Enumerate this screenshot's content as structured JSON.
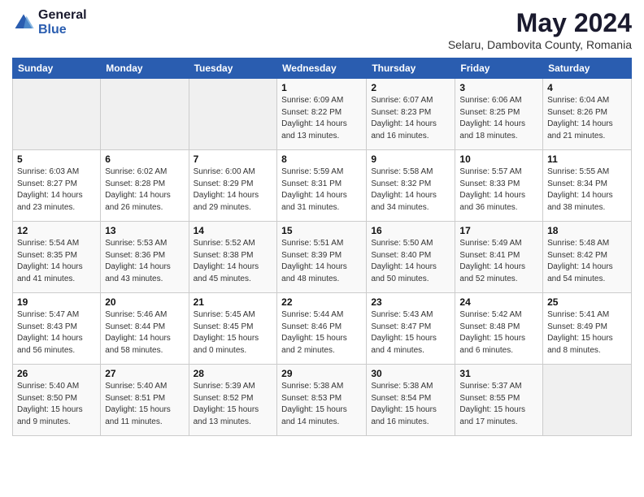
{
  "header": {
    "logo_general": "General",
    "logo_blue": "Blue",
    "title": "May 2024",
    "subtitle": "Selaru, Dambovita County, Romania"
  },
  "columns": [
    "Sunday",
    "Monday",
    "Tuesday",
    "Wednesday",
    "Thursday",
    "Friday",
    "Saturday"
  ],
  "weeks": [
    [
      {
        "day": "",
        "info": ""
      },
      {
        "day": "",
        "info": ""
      },
      {
        "day": "",
        "info": ""
      },
      {
        "day": "1",
        "info": "Sunrise: 6:09 AM\nSunset: 8:22 PM\nDaylight: 14 hours\nand 13 minutes."
      },
      {
        "day": "2",
        "info": "Sunrise: 6:07 AM\nSunset: 8:23 PM\nDaylight: 14 hours\nand 16 minutes."
      },
      {
        "day": "3",
        "info": "Sunrise: 6:06 AM\nSunset: 8:25 PM\nDaylight: 14 hours\nand 18 minutes."
      },
      {
        "day": "4",
        "info": "Sunrise: 6:04 AM\nSunset: 8:26 PM\nDaylight: 14 hours\nand 21 minutes."
      }
    ],
    [
      {
        "day": "5",
        "info": "Sunrise: 6:03 AM\nSunset: 8:27 PM\nDaylight: 14 hours\nand 23 minutes."
      },
      {
        "day": "6",
        "info": "Sunrise: 6:02 AM\nSunset: 8:28 PM\nDaylight: 14 hours\nand 26 minutes."
      },
      {
        "day": "7",
        "info": "Sunrise: 6:00 AM\nSunset: 8:29 PM\nDaylight: 14 hours\nand 29 minutes."
      },
      {
        "day": "8",
        "info": "Sunrise: 5:59 AM\nSunset: 8:31 PM\nDaylight: 14 hours\nand 31 minutes."
      },
      {
        "day": "9",
        "info": "Sunrise: 5:58 AM\nSunset: 8:32 PM\nDaylight: 14 hours\nand 34 minutes."
      },
      {
        "day": "10",
        "info": "Sunrise: 5:57 AM\nSunset: 8:33 PM\nDaylight: 14 hours\nand 36 minutes."
      },
      {
        "day": "11",
        "info": "Sunrise: 5:55 AM\nSunset: 8:34 PM\nDaylight: 14 hours\nand 38 minutes."
      }
    ],
    [
      {
        "day": "12",
        "info": "Sunrise: 5:54 AM\nSunset: 8:35 PM\nDaylight: 14 hours\nand 41 minutes."
      },
      {
        "day": "13",
        "info": "Sunrise: 5:53 AM\nSunset: 8:36 PM\nDaylight: 14 hours\nand 43 minutes."
      },
      {
        "day": "14",
        "info": "Sunrise: 5:52 AM\nSunset: 8:38 PM\nDaylight: 14 hours\nand 45 minutes."
      },
      {
        "day": "15",
        "info": "Sunrise: 5:51 AM\nSunset: 8:39 PM\nDaylight: 14 hours\nand 48 minutes."
      },
      {
        "day": "16",
        "info": "Sunrise: 5:50 AM\nSunset: 8:40 PM\nDaylight: 14 hours\nand 50 minutes."
      },
      {
        "day": "17",
        "info": "Sunrise: 5:49 AM\nSunset: 8:41 PM\nDaylight: 14 hours\nand 52 minutes."
      },
      {
        "day": "18",
        "info": "Sunrise: 5:48 AM\nSunset: 8:42 PM\nDaylight: 14 hours\nand 54 minutes."
      }
    ],
    [
      {
        "day": "19",
        "info": "Sunrise: 5:47 AM\nSunset: 8:43 PM\nDaylight: 14 hours\nand 56 minutes."
      },
      {
        "day": "20",
        "info": "Sunrise: 5:46 AM\nSunset: 8:44 PM\nDaylight: 14 hours\nand 58 minutes."
      },
      {
        "day": "21",
        "info": "Sunrise: 5:45 AM\nSunset: 8:45 PM\nDaylight: 15 hours\nand 0 minutes."
      },
      {
        "day": "22",
        "info": "Sunrise: 5:44 AM\nSunset: 8:46 PM\nDaylight: 15 hours\nand 2 minutes."
      },
      {
        "day": "23",
        "info": "Sunrise: 5:43 AM\nSunset: 8:47 PM\nDaylight: 15 hours\nand 4 minutes."
      },
      {
        "day": "24",
        "info": "Sunrise: 5:42 AM\nSunset: 8:48 PM\nDaylight: 15 hours\nand 6 minutes."
      },
      {
        "day": "25",
        "info": "Sunrise: 5:41 AM\nSunset: 8:49 PM\nDaylight: 15 hours\nand 8 minutes."
      }
    ],
    [
      {
        "day": "26",
        "info": "Sunrise: 5:40 AM\nSunset: 8:50 PM\nDaylight: 15 hours\nand 9 minutes."
      },
      {
        "day": "27",
        "info": "Sunrise: 5:40 AM\nSunset: 8:51 PM\nDaylight: 15 hours\nand 11 minutes."
      },
      {
        "day": "28",
        "info": "Sunrise: 5:39 AM\nSunset: 8:52 PM\nDaylight: 15 hours\nand 13 minutes."
      },
      {
        "day": "29",
        "info": "Sunrise: 5:38 AM\nSunset: 8:53 PM\nDaylight: 15 hours\nand 14 minutes."
      },
      {
        "day": "30",
        "info": "Sunrise: 5:38 AM\nSunset: 8:54 PM\nDaylight: 15 hours\nand 16 minutes."
      },
      {
        "day": "31",
        "info": "Sunrise: 5:37 AM\nSunset: 8:55 PM\nDaylight: 15 hours\nand 17 minutes."
      },
      {
        "day": "",
        "info": ""
      }
    ]
  ]
}
